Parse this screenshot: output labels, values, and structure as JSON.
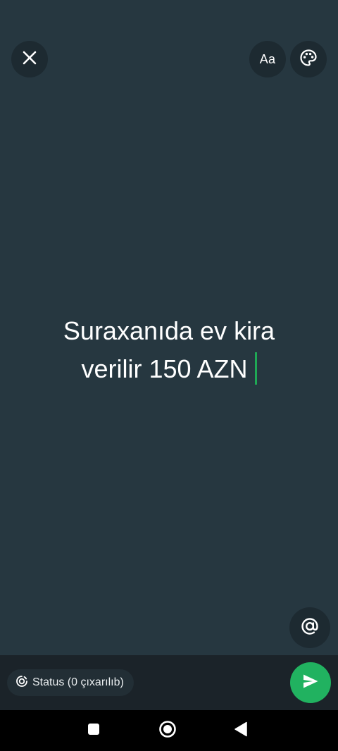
{
  "composer": {
    "text_line1": "Suraxanıda ev kira",
    "text_line2": "verilir 150 AZN",
    "background_color": "#263740",
    "caret_color": "#1fa855"
  },
  "top_controls": {
    "close_icon": "close-icon",
    "font_icon": "font-style-icon",
    "font_label": "Aa",
    "palette_icon": "palette-icon"
  },
  "mention": {
    "icon": "at-sign-icon"
  },
  "bottom_bar": {
    "audience_icon": "status-ring-icon",
    "audience_label": "Status (0 çıxarılıb)",
    "send_icon": "send-icon",
    "send_color": "#21b260"
  },
  "system_nav": {
    "recents_icon": "square-icon",
    "home_icon": "circle-icon",
    "back_icon": "triangle-back-icon"
  }
}
